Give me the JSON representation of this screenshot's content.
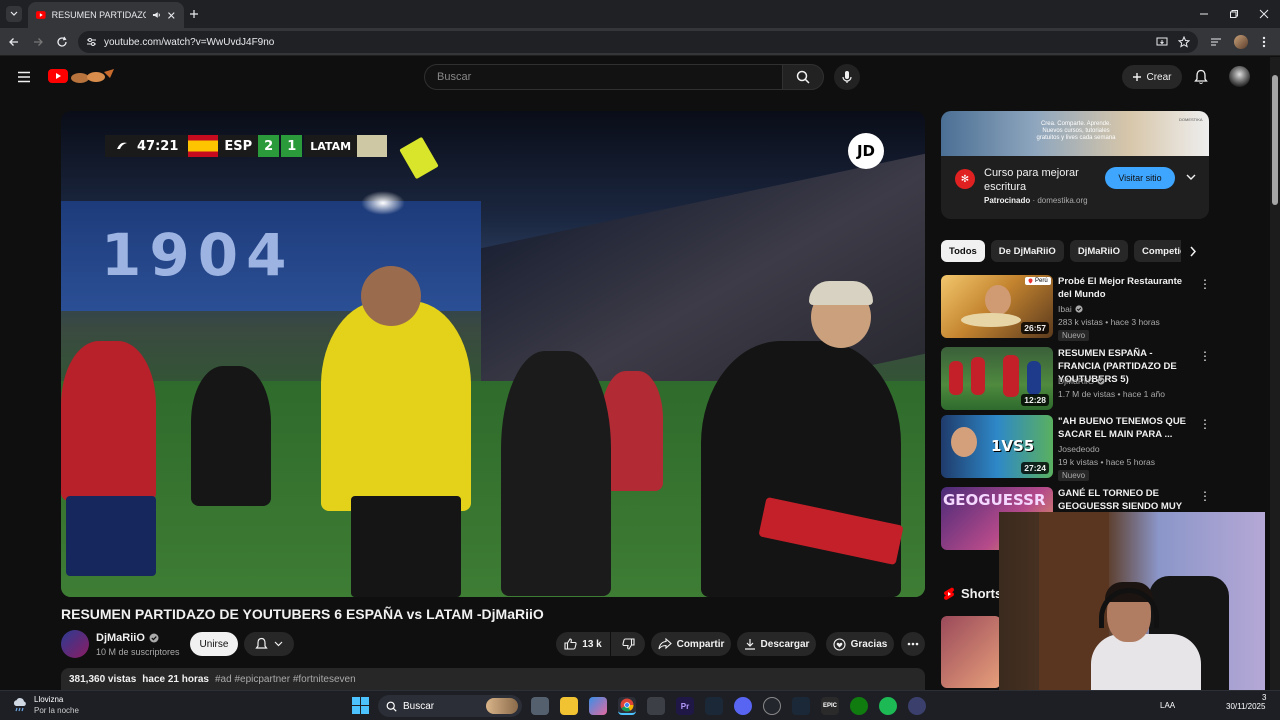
{
  "browser": {
    "tab_title": "RESUMEN PARTIDAZO DE Y",
    "url": "youtube.com/watch?v=WwUvdJ4F9no"
  },
  "header": {
    "search_placeholder": "Buscar",
    "create_label": "Crear"
  },
  "video": {
    "scoreboard": {
      "time": "47:21",
      "home": "ESP",
      "home_score": "2",
      "away_score": "1",
      "away": "LATAM"
    },
    "stadium_banner": "1904",
    "sponsor_logo": "JD",
    "title": "RESUMEN PARTIDAZO DE YOUTUBERS 6 ESPAÑA vs LATAM -DjMaRiiO",
    "channel": "DjMaRiiO",
    "subscribers": "10 M de suscriptores",
    "join_label": "Unirse",
    "likes": "13 k",
    "share_label": "Compartir",
    "download_label": "Descargar",
    "thanks_label": "Gracias",
    "views": "381,360 vistas",
    "published": "hace 21 horas",
    "hashtags": "#ad #epicpartner #fortniteseven"
  },
  "ad": {
    "banner_brand": "DOMESTIKA",
    "banner_text": "Crea. Comparte. Aprende.\nNuevos cursos, tutoriales\ngratuitos y lives cada semana",
    "title": "Curso para mejorar escritura",
    "sponsored": "Patrocinado",
    "domain": "domestika.org",
    "cta": "Visitar sitio"
  },
  "chips": [
    "Todos",
    "De DjMaRiiO",
    "DjMaRiiO",
    "Competici"
  ],
  "recommendations": [
    {
      "title": "Probé El Mejor Restaurante del Mundo",
      "channel": "Ibai",
      "verified": true,
      "views": "283 k vistas • hace 3 horas",
      "duration": "26:57",
      "badge": "Nuevo",
      "thumb_tag": "Perú"
    },
    {
      "title": "RESUMEN ESPAÑA - FRANCIA (PARTIDAZO DE YOUTUBERS 5)",
      "channel": "DjMaRiiO",
      "verified": true,
      "views": "1.7 M de vistas • hace 1 año",
      "duration": "12:28",
      "badge": ""
    },
    {
      "title": "\"AH BUENO TENEMOS QUE SACAR EL MAIN PARA ...",
      "channel": "Josedeodo",
      "verified": false,
      "views": "19 k vistas • hace 5 horas",
      "duration": "27:24",
      "badge": "Nuevo",
      "thumb_tag": "1VS5"
    },
    {
      "title": "GANÉ EL TORNEO DE GEOGUESSR SIENDO MUY ...",
      "channel": "",
      "verified": false,
      "views": "",
      "duration": "",
      "badge": "",
      "thumb_tag": "GEOGUESSR"
    }
  ],
  "shorts_label": "Shorts",
  "taskbar": {
    "weather_title": "Llovizna",
    "weather_sub": "Por la noche",
    "search_label": "Buscar",
    "lang": "LAA",
    "date": "30/11/2025",
    "time_fragment": "3"
  },
  "colors": {
    "bg": "#0f0f0f",
    "accent_blue": "#3ea6ff",
    "youtube_red": "#ff0000",
    "referee_yellow": "#e4d21a"
  }
}
